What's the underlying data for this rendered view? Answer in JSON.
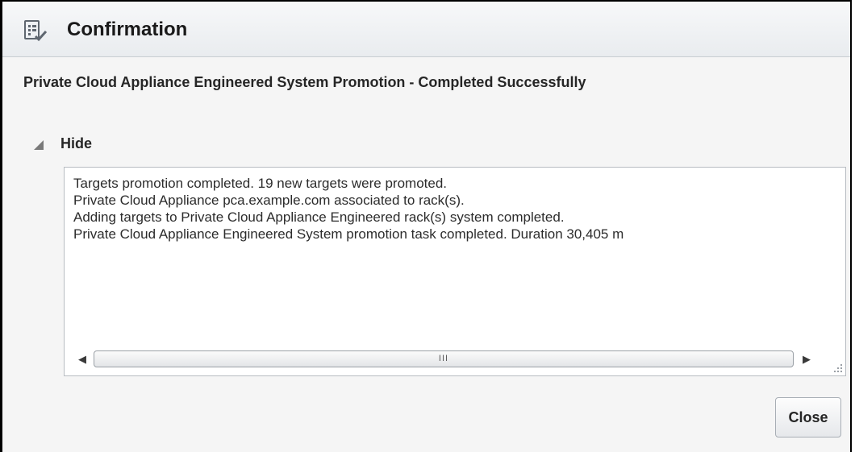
{
  "dialog": {
    "title": "Confirmation",
    "heading": "Private Cloud Appliance Engineered System Promotion - Completed Successfully",
    "disclosure_label": "Hide",
    "details_lines": [
      "Targets promotion completed. 19 new targets were promoted.",
      "Private Cloud Appliance pca.example.com associated to rack(s).",
      "Adding targets to Private Cloud Appliance Engineered rack(s) system completed.",
      "Private Cloud Appliance Engineered System promotion task completed. Duration 30,405 m"
    ],
    "scrollbar_grip": "III",
    "close_label": "Close"
  },
  "icons": {
    "title_icon": "task-list-check-icon",
    "disclosure_icon": "triangle-expanded-icon",
    "scroll_left_icon": "arrow-left-icon",
    "scroll_right_icon": "arrow-right-icon",
    "resize_icon": "resize-grip-icon"
  },
  "colors": {
    "titlebar": "#e9ecef",
    "dialog_background": "#f5f5f5",
    "border": "#000000",
    "text": "#262626"
  }
}
